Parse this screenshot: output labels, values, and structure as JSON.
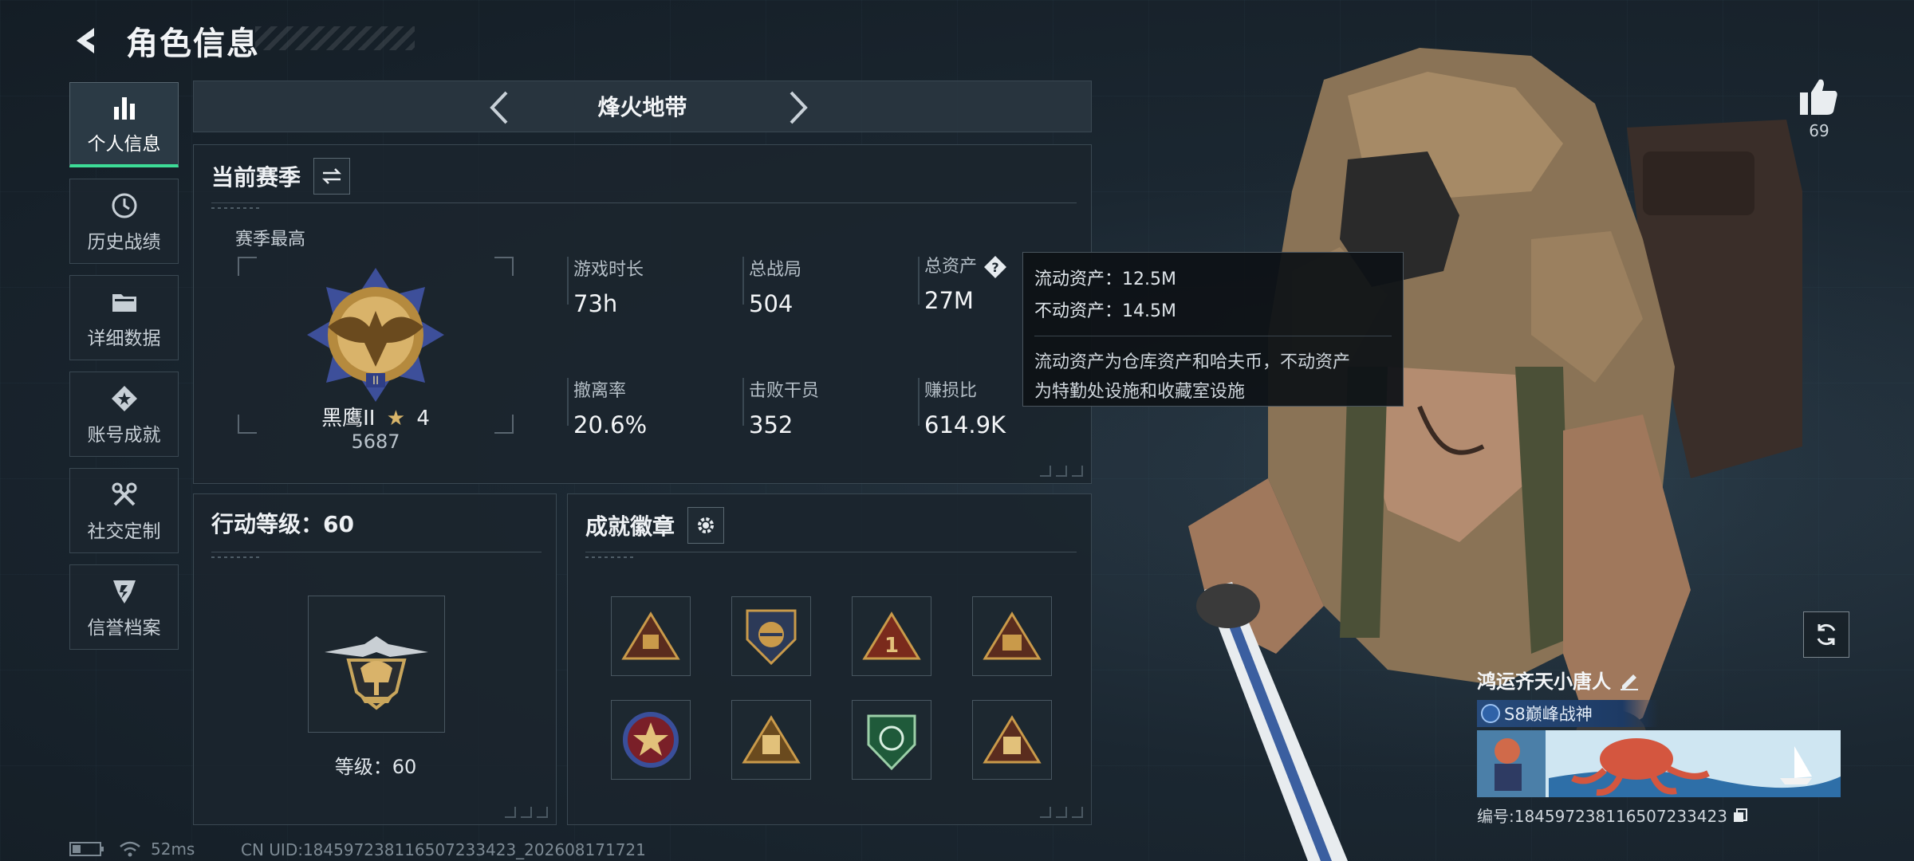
{
  "header": {
    "title": "角色信息"
  },
  "sidebar": {
    "items": [
      {
        "label": "个人信息",
        "icon": "bar-chart-icon",
        "active": true
      },
      {
        "label": "历史战绩",
        "icon": "history-icon"
      },
      {
        "label": "详细数据",
        "icon": "folder-icon"
      },
      {
        "label": "账号成就",
        "icon": "achievement-icon"
      },
      {
        "label": "社交定制",
        "icon": "tools-icon"
      },
      {
        "label": "信誉档案",
        "icon": "shield-icon"
      }
    ]
  },
  "mode": {
    "title": "烽火地带"
  },
  "season": {
    "title": "当前赛季",
    "best_label": "赛季最高",
    "rank_name": "黑鹰II",
    "rank_stars": "4",
    "rank_score": "5687",
    "stats": [
      {
        "label": "游戏时长",
        "value": "73h"
      },
      {
        "label": "总战局",
        "value": "504"
      },
      {
        "label": "总资产",
        "value": "27M"
      },
      {
        "label": "撤离率",
        "value": "20.6%"
      },
      {
        "label": "击败干员",
        "value": "352"
      },
      {
        "label": "赚损比",
        "value": "614.9K"
      }
    ]
  },
  "tooltip": {
    "liquid": "流动资产：12.5M",
    "fixed": "不动资产：14.5M",
    "desc_line1": "流动资产为仓库资产和哈夫币，不动资产",
    "desc_line2": "为特勤处设施和收藏室设施"
  },
  "level": {
    "title": "行动等级：60",
    "text": "等级：60"
  },
  "badges": {
    "title": "成就徽章"
  },
  "likes": {
    "count": "69"
  },
  "player": {
    "name": "鸿运齐天小唐人",
    "title": "S8巅峰战神",
    "id": "编号:184597238116507233423"
  },
  "status": {
    "ping": "52ms",
    "uid": "CN UID:184597238116507233423_202608171721"
  },
  "colors": {
    "accent": "#3ddc97",
    "panel": "#1b252e",
    "title_bg": "#274b7c"
  }
}
